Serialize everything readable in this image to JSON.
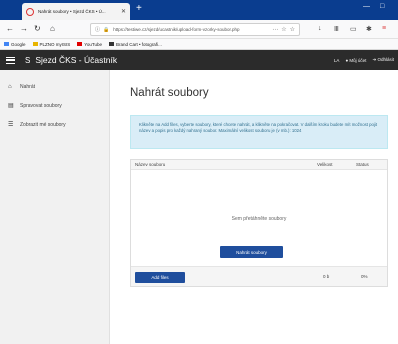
{
  "browser": {
    "tab_title": "Nahrát soubory • Sjezd ČKS • Ú...",
    "tab_close": "✕",
    "new_tab": "+",
    "window_controls": [
      "—",
      "□"
    ],
    "url": "https://testiwe.cz/sjezd/ucastnik/upload-form-vzorky-soubor.php",
    "url_controls": [
      "···",
      "☆",
      "☆"
    ],
    "bookmarks": [
      {
        "label": "Google",
        "color": "#ffffff"
      },
      {
        "label": "PLZNO myISIS",
        "color": "#e8b400"
      },
      {
        "label": "YouTube",
        "color": "#e00000"
      },
      {
        "label": "Brand Cart • fotografi...",
        "color": "#333333"
      }
    ]
  },
  "app": {
    "logo": "S",
    "title": "Sjezd ČKS - Účastník",
    "header_right": [
      "LA",
      "Můj účet",
      "Odhlásit"
    ]
  },
  "sidebar": {
    "items": [
      {
        "label": "Nahrát",
        "icon": "home-icon"
      },
      {
        "label": "Spravovat soubory",
        "icon": "file-icon"
      },
      {
        "label": "Zobrazit mé soubory",
        "icon": "list-icon"
      }
    ]
  },
  "main": {
    "title": "Nahrát soubory",
    "info_text": "Klikněte na Add files, vyberte soubory, které chcete nahrát, a klikněte na pokračovat. V dalším kroku budete mít možnost pojit název a popis pro každý nahraný soubor. Maximální velikost souboru je (v mb.): 1024",
    "table": {
      "col_name": "Název souboru",
      "col_size": "Velikost",
      "col_status": "Status"
    },
    "dropzone_text": "Sem přetáhněte soubory",
    "add_button": "Add files",
    "total_size": "0 b",
    "total_pct": "0%",
    "submit_button": "Nahrát soubory"
  },
  "colors": {
    "accent": "#1f4e9d",
    "header_bg": "#2b2b2b",
    "tab_bg": "#0a3d8f",
    "info_bg": "#d9edf7"
  }
}
